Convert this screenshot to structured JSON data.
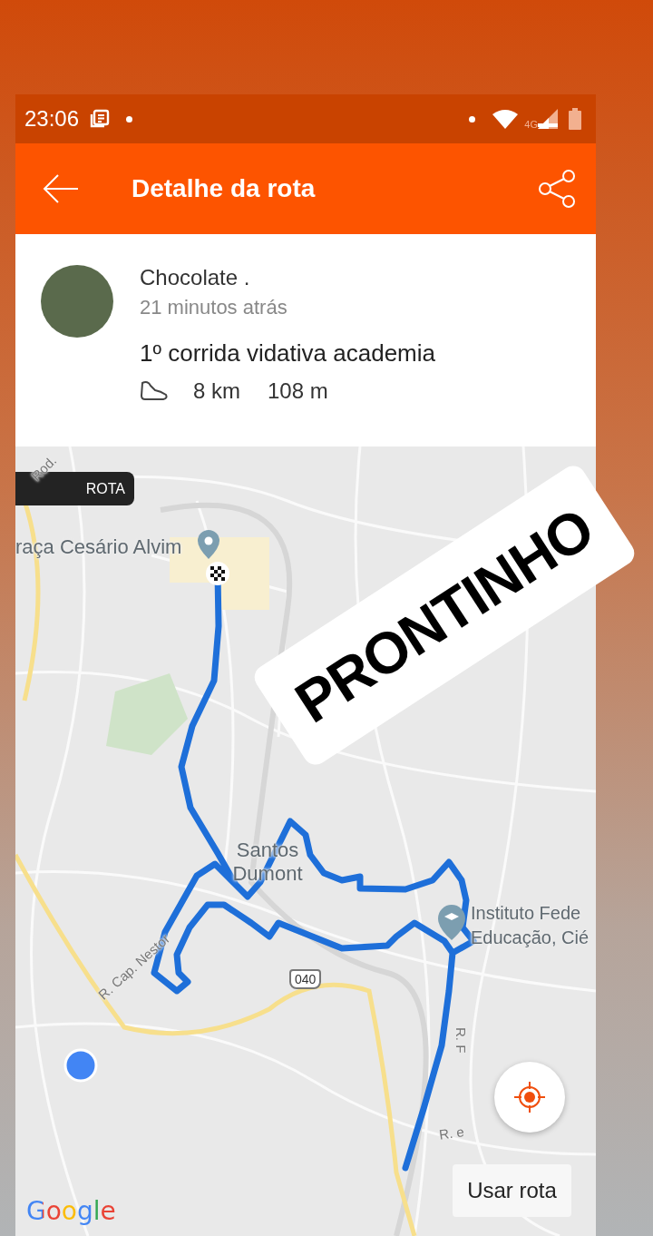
{
  "status_bar": {
    "time": "23:06",
    "network": "4G"
  },
  "app_bar": {
    "title": "Detalhe da rota"
  },
  "activity": {
    "author": "Chocolate .",
    "time_ago": "21 minutos atrás",
    "title": "1º corrida vidativa academia",
    "distance": "8 km",
    "elevation": "108 m"
  },
  "map": {
    "badge": "ROTA",
    "labels": [
      {
        "kind": "street",
        "text": "Rod."
      },
      {
        "kind": "place",
        "text": "raça Cesário Alvim"
      },
      {
        "kind": "place",
        "text": "Santos Dumont"
      },
      {
        "kind": "place",
        "text": "Instituto Fede"
      },
      {
        "kind": "place",
        "text": "Educação, Cié"
      },
      {
        "kind": "street",
        "text": "R. Cap. Nestor"
      },
      {
        "kind": "street",
        "text": "R. F"
      },
      {
        "kind": "street",
        "text": "R. e"
      }
    ],
    "shield": "040",
    "action": "Usar rota",
    "attribution": "Google"
  },
  "sticker": {
    "text": "PRONTINHO"
  }
}
